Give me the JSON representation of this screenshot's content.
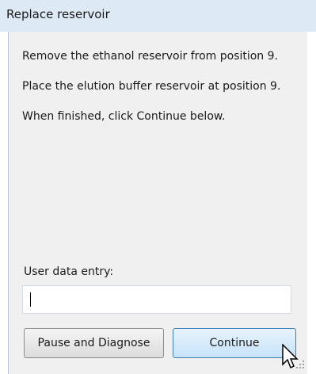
{
  "window": {
    "title": "Replace reservoir"
  },
  "instructions": [
    "Remove the ethanol reservoir from position 9.",
    "Place the elution buffer reservoir at position 9.",
    "When finished, click Continue below."
  ],
  "user_data": {
    "label": "User data entry:",
    "value": ""
  },
  "buttons": {
    "pause_label": "Pause and Diagnose",
    "continue_label": "Continue"
  }
}
